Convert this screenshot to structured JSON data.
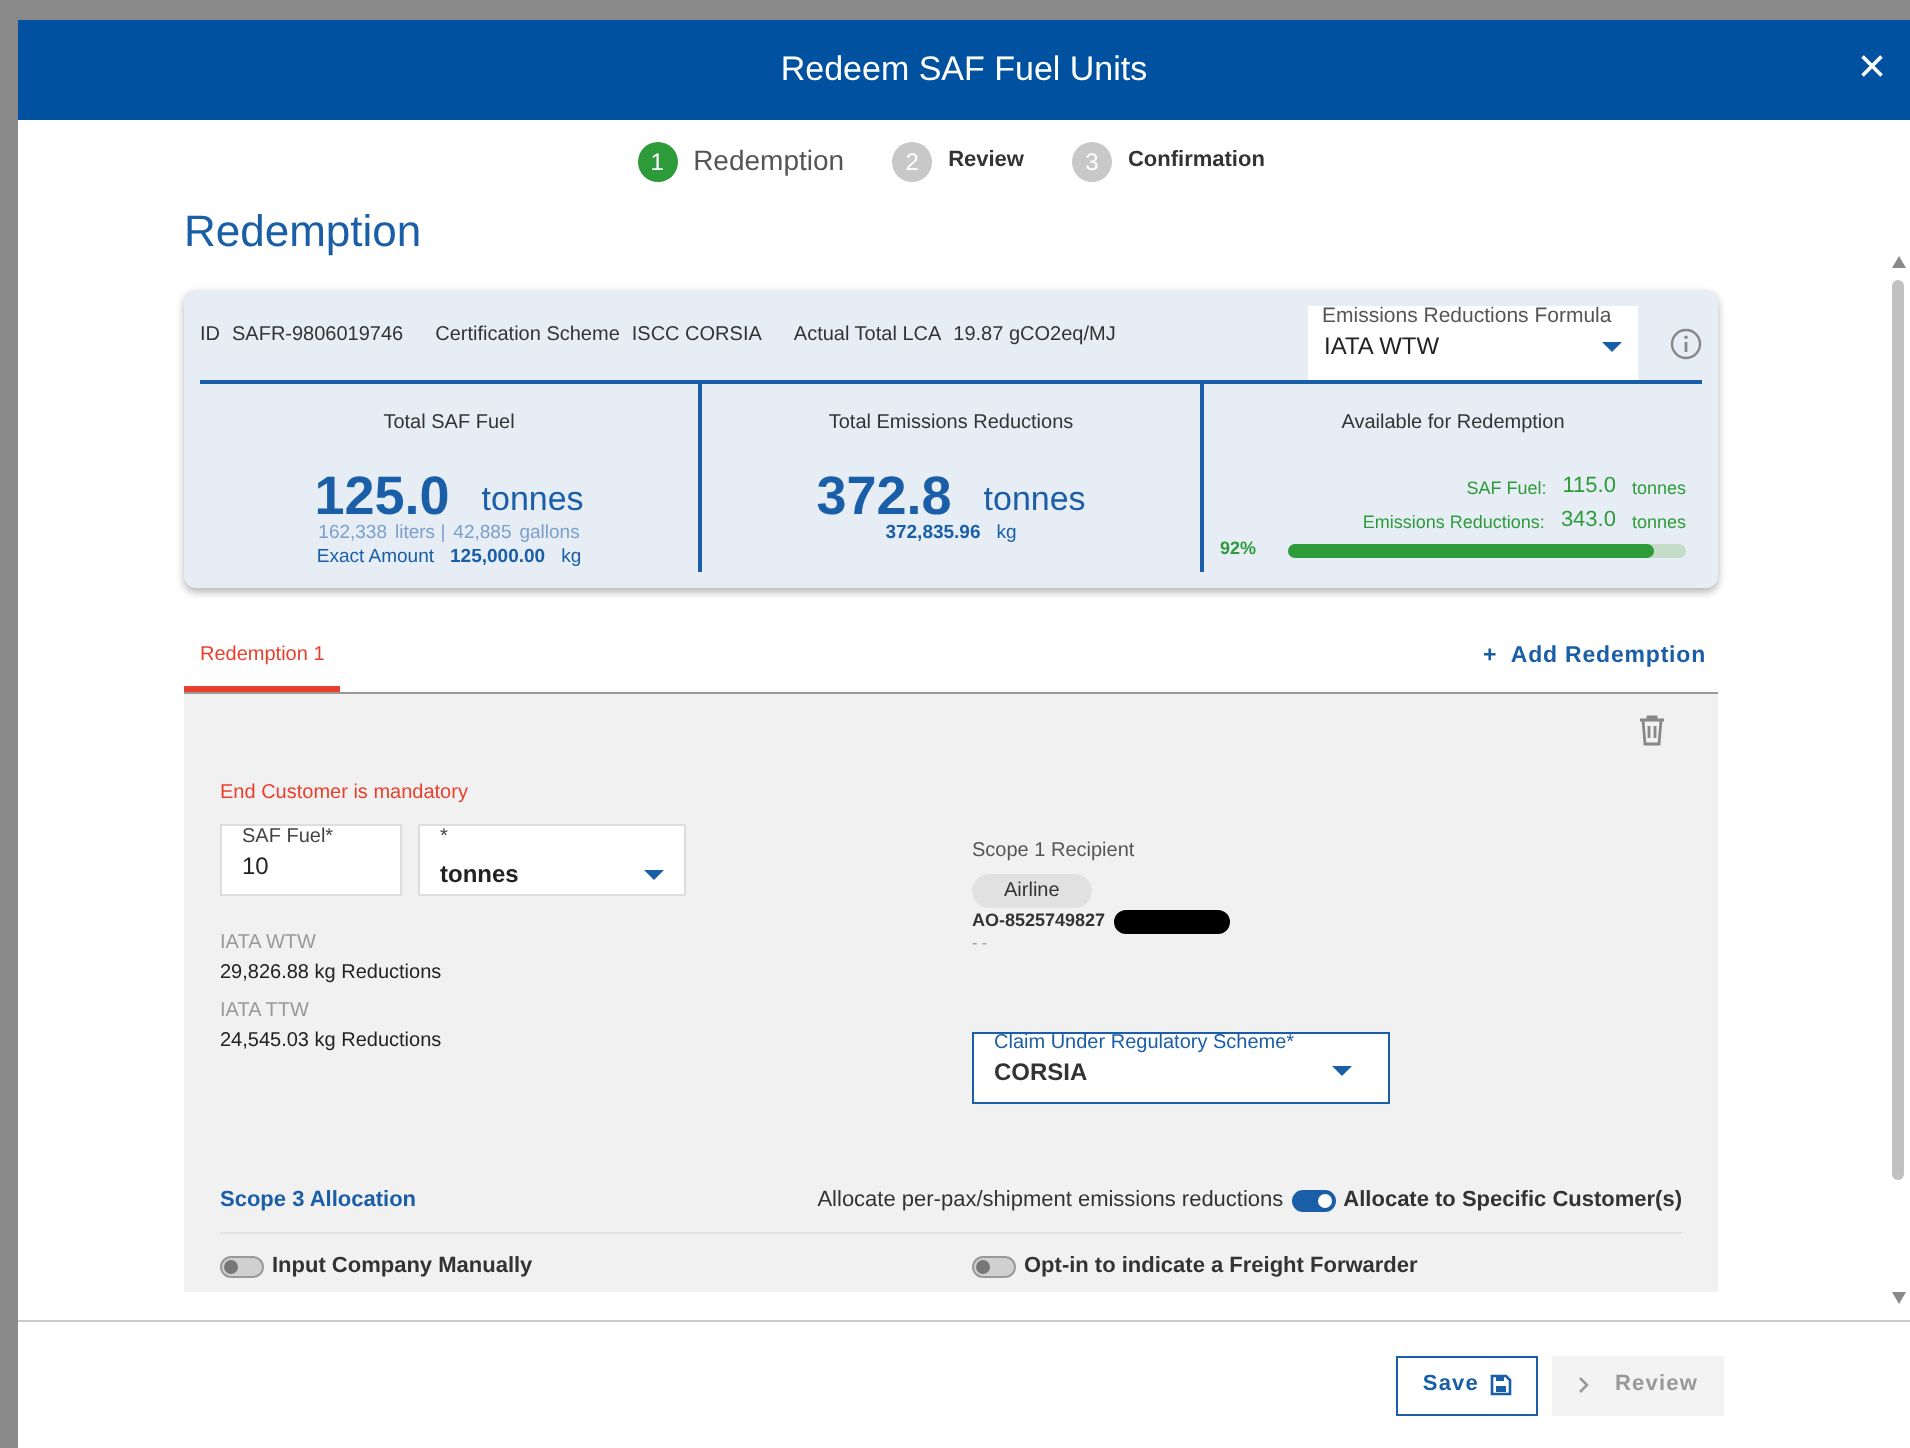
{
  "window": {
    "title": "Redeem SAF Fuel Units",
    "close": "×"
  },
  "steps": [
    {
      "number": "1",
      "label": "Redemption",
      "selected": true
    },
    {
      "number": "2",
      "label": "Review",
      "selected": false
    },
    {
      "number": "3",
      "label": "Confirmation",
      "selected": false
    }
  ],
  "heading": "Redemption",
  "summary": {
    "id_label": "ID",
    "id": "SAFR-9806019746",
    "scheme_label": "Certification Scheme",
    "scheme": "ISCC CORSIA",
    "lca_label": "Actual Total LCA",
    "lca": "19.87 gCO2eq/MJ",
    "formula": {
      "label": "Emissions Reductions Formula",
      "value": "IATA WTW"
    },
    "fuel": {
      "title": "Total SAF Fuel",
      "amount": "125.0",
      "unit": "tonnes",
      "liters": "162,338",
      "liters_unit": "liters |",
      "gallons": "42,885",
      "gallons_unit": "gallons",
      "exact_label": "Exact Amount",
      "exact": "125,000.00",
      "exact_unit": "kg"
    },
    "emissions": {
      "title": "Total Emissions Reductions",
      "amount": "372.8",
      "unit": "tonnes",
      "kg": "372,835.96",
      "kg_unit": "kg"
    },
    "available": {
      "title": "Available for Redemption",
      "fuel_label": "SAF Fuel:",
      "fuel": "115.0",
      "fuel_unit": "tonnes",
      "em_label": "Emissions Reductions:",
      "em": "343.0",
      "em_unit": "tonnes",
      "percent": "92%",
      "level": 0.92
    }
  },
  "tabs": [
    {
      "label": "Redemption 1",
      "selected": true
    }
  ],
  "add_button": {
    "icon": "+",
    "label": "Add Redemption"
  },
  "redemption": {
    "error": "End Customer is mandatory",
    "fuel_field": {
      "label": "SAF Fuel*",
      "value": "10"
    },
    "unit_field": {
      "label": "*",
      "value": "tonnes"
    },
    "results": [
      {
        "label": "IATA WTW",
        "value": "29,826.88 kg Reductions"
      },
      {
        "label": "IATA TTW",
        "value": "24,545.03 kg Reductions"
      }
    ],
    "recipient": {
      "label": "Scope 1 Recipient",
      "tag": "Airline",
      "id": "AO-8525749827",
      "note": "- -"
    },
    "scheme_field": {
      "label": "Claim Under Regulatory Scheme*",
      "value": "CORSIA"
    },
    "scope3": {
      "title": "Scope 3 Allocation",
      "left_label": "Allocate per-pax/shipment emissions reductions",
      "right_label": "Allocate to Specific Customer(s)",
      "on": true
    },
    "toggles": [
      {
        "label": "Input Company Manually",
        "on": false
      },
      {
        "label": "Opt-in to indicate a Freight Forwarder",
        "on": false
      }
    ]
  },
  "footer": [
    {
      "label": "Save",
      "kind": "save",
      "disabled": false
    },
    {
      "label": "Review",
      "kind": "next",
      "disabled": true
    }
  ]
}
